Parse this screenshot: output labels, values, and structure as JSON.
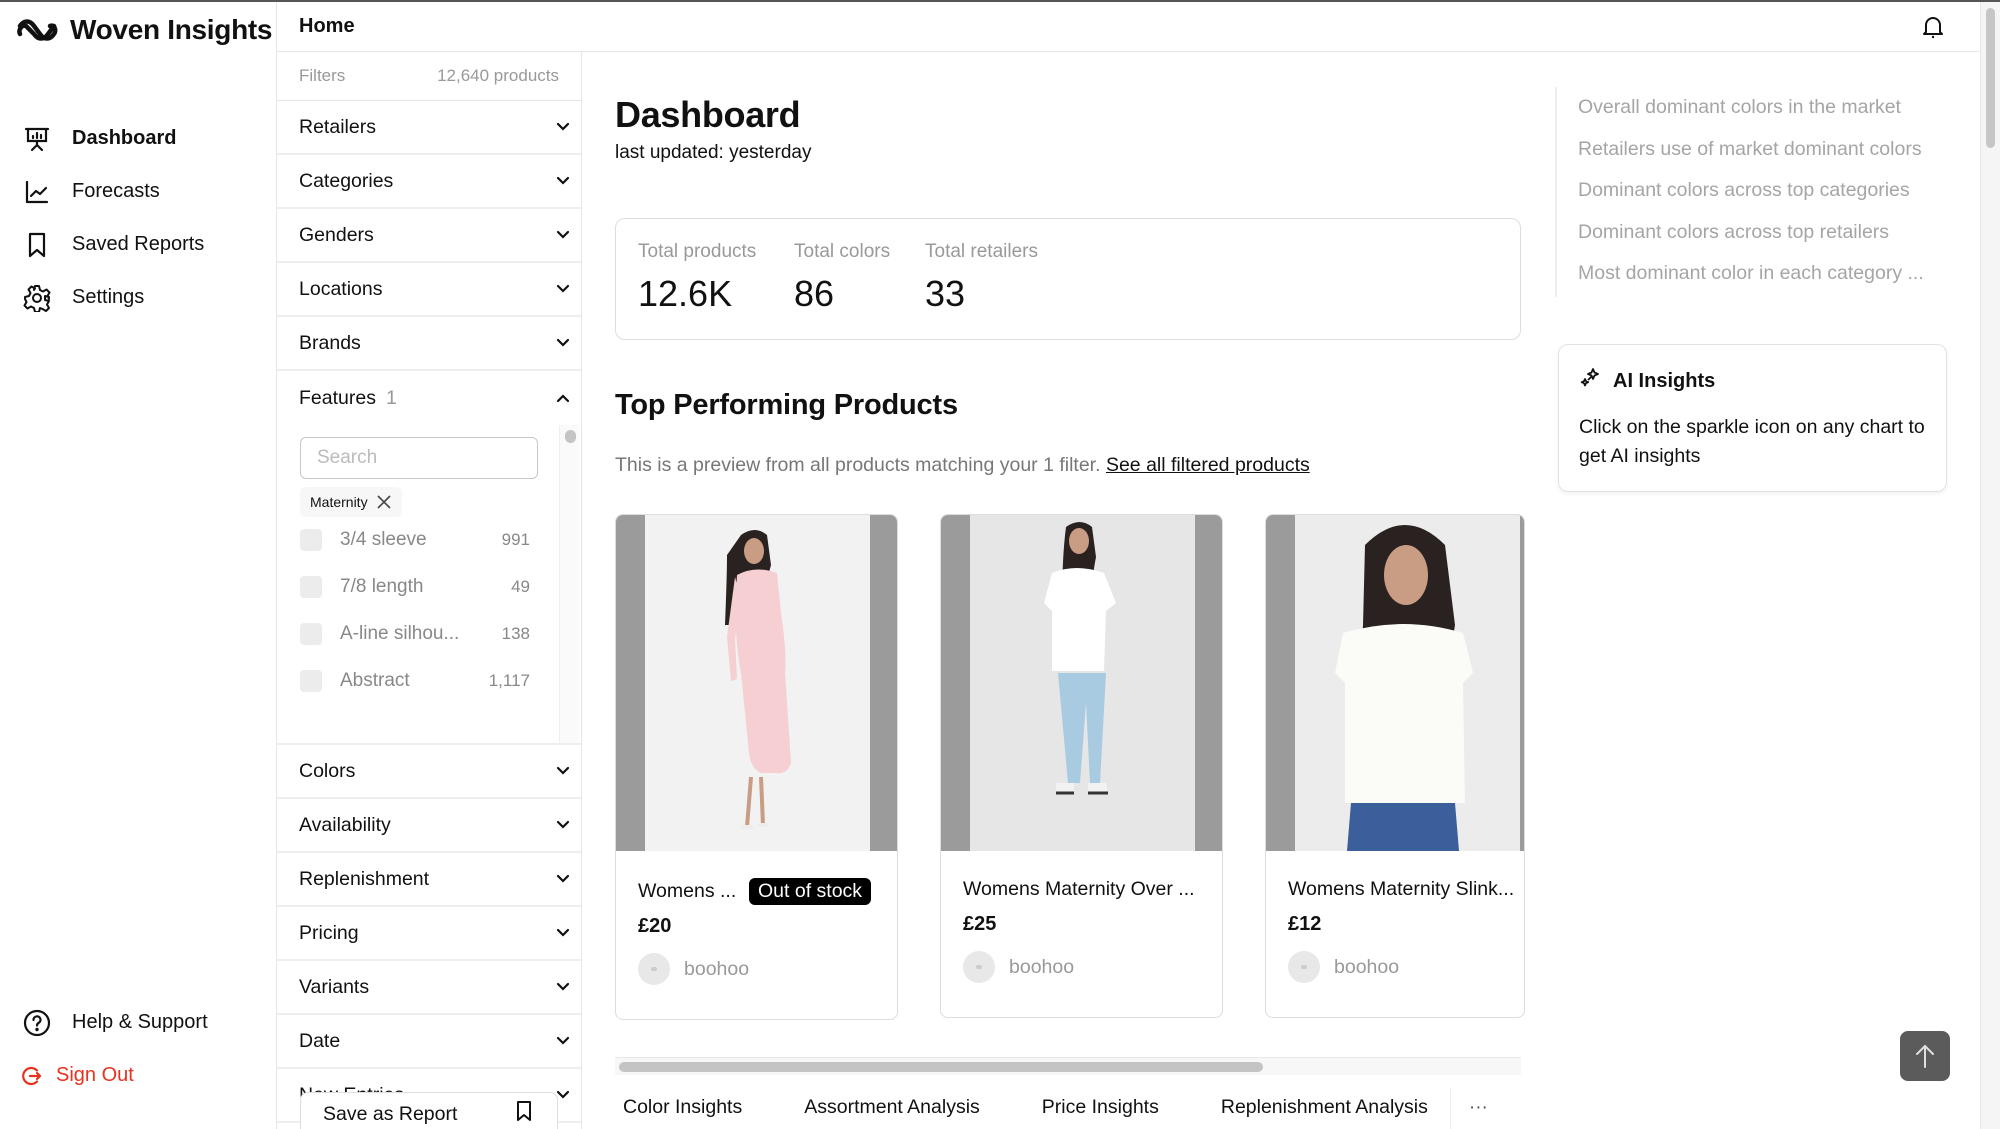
{
  "app": {
    "name": "Woven Insights"
  },
  "nav": {
    "items": [
      {
        "label": "Dashboard",
        "icon": "presentation-chart-icon",
        "active": true
      },
      {
        "label": "Forecasts",
        "icon": "line-chart-icon",
        "active": false
      },
      {
        "label": "Saved Reports",
        "icon": "bookmark-icon",
        "active": false
      },
      {
        "label": "Settings",
        "icon": "gear-icon",
        "active": false
      }
    ],
    "bottom": [
      {
        "label": "Help & Support",
        "icon": "help-circle-icon"
      },
      {
        "label": "Sign Out",
        "icon": "sign-out-icon"
      }
    ]
  },
  "header": {
    "breadcrumb": "Home",
    "bell_icon": "bell-icon"
  },
  "filters": {
    "title": "Filters",
    "product_count": "12,640 products",
    "groups_top": [
      "Retailers",
      "Categories",
      "Genders",
      "Locations",
      "Brands"
    ],
    "features": {
      "label": "Features",
      "count": "1",
      "search_placeholder": "Search",
      "selected_chip": "Maternity",
      "options": [
        {
          "label": "3/4 sleeve",
          "count": "991"
        },
        {
          "label": "7/8 length",
          "count": "49"
        },
        {
          "label": "A-line silhou...",
          "count": "138"
        },
        {
          "label": "Abstract",
          "count": "1,117"
        }
      ]
    },
    "groups_bottom": [
      "Colors",
      "Availability",
      "Replenishment",
      "Pricing",
      "Variants",
      "Date",
      "New Entries"
    ],
    "save_label": "Save as Report"
  },
  "main": {
    "title": "Dashboard",
    "last_updated": "last updated: yesterday",
    "stats": [
      {
        "label": "Total products",
        "value": "12.6K"
      },
      {
        "label": "Total colors",
        "value": "86"
      },
      {
        "label": "Total retailers",
        "value": "33"
      }
    ],
    "section_title": "Top Performing Products",
    "preview_text": "This is a preview from all products matching your 1 filter.",
    "preview_link": "See all filtered products",
    "products": [
      {
        "name": "Womens ...",
        "badge": "Out of stock",
        "price": "£20",
        "retailer": "boohoo",
        "garment": "pink-maxi-dress"
      },
      {
        "name": "Womens Maternity Over ...",
        "badge": "",
        "price": "£25",
        "retailer": "boohoo",
        "garment": "white-tee-jeans"
      },
      {
        "name": "Womens Maternity Slink...",
        "badge": "",
        "price": "£12",
        "retailer": "boohoo",
        "garment": "white-top-closeup"
      }
    ],
    "tabs": [
      "Color Insights",
      "Assortment Analysis",
      "Price Insights",
      "Replenishment Analysis"
    ],
    "tabs_more": "···"
  },
  "right": {
    "toc": [
      "Overall dominant colors in the market",
      "Retailers use of market dominant colors",
      "Dominant colors across top categories",
      "Dominant colors across top retailers",
      "Most dominant color in each category ..."
    ],
    "ai": {
      "title": "AI Insights",
      "text": "Click on the sparkle icon on any chart to get AI insights"
    }
  }
}
